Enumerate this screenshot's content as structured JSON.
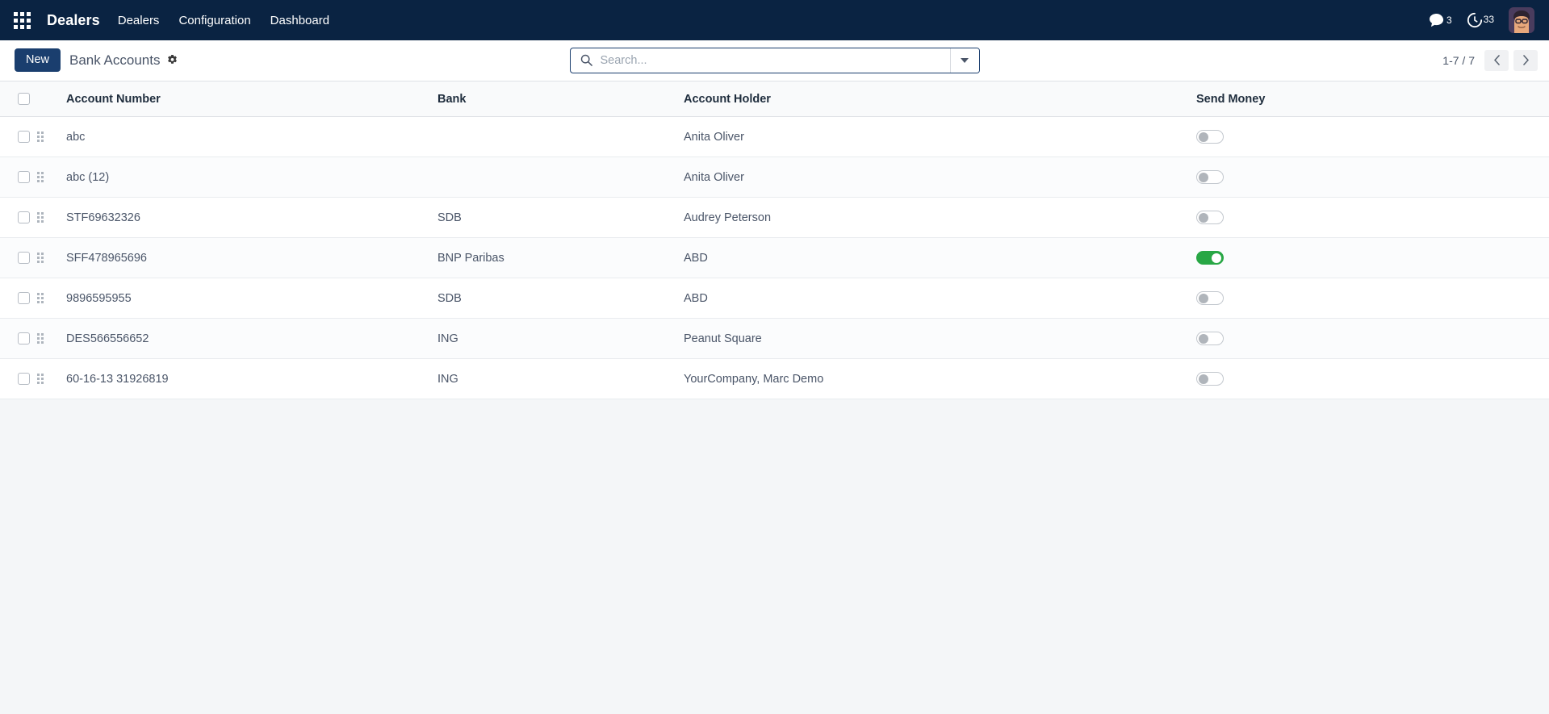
{
  "navbar": {
    "apps_icon": "apps-grid-icon",
    "brand": "Dealers",
    "menu_items": [
      {
        "label": "Dealers"
      },
      {
        "label": "Configuration"
      },
      {
        "label": "Dashboard"
      }
    ],
    "systray": {
      "messages_icon": "chat-bubble-icon",
      "messages_count": "3",
      "activities_icon": "clock-activity-icon",
      "activities_count": "33",
      "avatar_name": "user-avatar"
    },
    "background_color": "#0a2342"
  },
  "control_panel": {
    "new_button": "New",
    "title": "Bank Accounts",
    "gear_icon": "gear-icon",
    "search": {
      "icon": "search-icon",
      "placeholder": "Search...",
      "value": "",
      "dropdown_icon": "chevron-down-icon"
    },
    "pager": {
      "range": "1-7 / 7",
      "previous_icon": "chevron-left-icon",
      "next_icon": "chevron-right-icon"
    }
  },
  "list": {
    "columns": [
      {
        "key": "account_number",
        "label": "Account Number"
      },
      {
        "key": "bank",
        "label": "Bank"
      },
      {
        "key": "account_holder",
        "label": "Account Holder"
      },
      {
        "key": "send_money",
        "label": "Send Money"
      }
    ],
    "rows": [
      {
        "account_number": "abc",
        "bank": "",
        "account_holder": "Anita Oliver",
        "send_money": false
      },
      {
        "account_number": "abc (12)",
        "bank": "",
        "account_holder": "Anita Oliver",
        "send_money": false
      },
      {
        "account_number": "STF69632326",
        "bank": "SDB",
        "account_holder": "Audrey Peterson",
        "send_money": false
      },
      {
        "account_number": "SFF478965696",
        "bank": "BNP Paribas",
        "account_holder": "ABD",
        "send_money": true
      },
      {
        "account_number": "9896595955",
        "bank": "SDB",
        "account_holder": "ABD",
        "send_money": false
      },
      {
        "account_number": "DES566556652",
        "bank": "ING",
        "account_holder": "Peanut Square",
        "send_money": false
      },
      {
        "account_number": "60-16-13 31926819",
        "bank": "ING",
        "account_holder": "YourCompany, Marc Demo",
        "send_money": false
      }
    ]
  },
  "colors": {
    "brand_navy": "#0a2342",
    "button_navy": "#1a3e6e",
    "toggle_on_green": "#28a745",
    "page_background": "#f4f6f8",
    "row_border": "#e9ecef"
  }
}
